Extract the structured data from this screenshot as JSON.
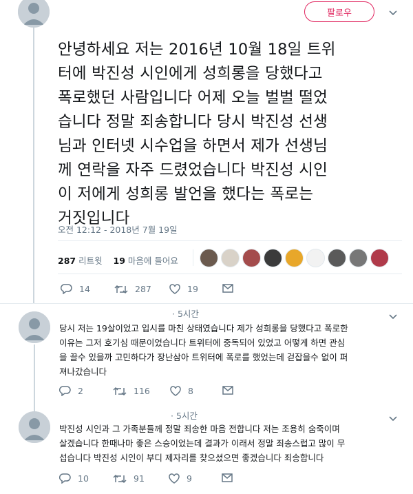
{
  "header": {
    "follow_label": "팔로우"
  },
  "main_tweet": {
    "lines": [
      "안녕하세요 저는 2016년 10월 18일 트위",
      "터에 박진성 시인에게 성희롱을 당했다고",
      "폭로했던 사람입니다 어제 오늘 벌벌 떨었",
      "습니다 정말 죄송합니다 당시 박진성 선생",
      "님과 인터넷 시수업을 하면서 제가 선생님",
      "께 연락을 자주 드렸었습니다 박진성 시인",
      "이 저에게 성희롱 발언을 했다는 폭로는",
      "거짓입니다"
    ],
    "timestamp": "오전 12:12 - 2018년 7월 19일",
    "retweets_count": "287",
    "retweets_label": "리트윗",
    "likes_count": "19",
    "likes_label": "마음에 들어요",
    "actions": {
      "reply": "14",
      "retweet": "287",
      "like": "19"
    }
  },
  "likers": [
    {
      "color": "#6b5a4e"
    },
    {
      "color": "#d9d2c8"
    },
    {
      "color": "#a44c4c"
    },
    {
      "color": "#3b3b3b"
    },
    {
      "color": "#e8a72a"
    },
    {
      "color": "#f2f2f2"
    },
    {
      "color": "#5a5a5a"
    },
    {
      "color": "#777777"
    },
    {
      "color": "#b03a4a"
    }
  ],
  "replies": [
    {
      "time": "· 5시간",
      "lines": [
        "당시 저는 19살이었고 입시를 마친 상태였습니다 제가 성희롱을 당했다고 폭로한",
        "이유는 그저 호기심 때문이었습니다 트위터에 중독되어 있었고 어떻게 하면 관심",
        "을 끌수 있을까 고민하다가 장난삼아 트위터에 폭로를 했었는데 걷잡을수 없이 퍼",
        "져나갔습니다"
      ],
      "reply": "2",
      "retweet": "116",
      "like": "8"
    },
    {
      "time": "· 5시간",
      "lines": [
        "박진성 시인과 그 가족분들께 정말 죄송한 마음 전합니다 저는 조용히 숨죽이며",
        "살겠습니다 한때나마 좋은 스승이었는데 결과가 이래서 정말 죄송스럽고 많이 무",
        "섭습니다 박진성 시인이 부디 제자리를 찾으셨으면 좋겠습니다 죄송합니다"
      ],
      "reply": "10",
      "retweet": "91",
      "like": "9"
    }
  ],
  "colors": {
    "accent": "#e0245e",
    "muted": "#657786",
    "text": "#14171a",
    "divider": "#e6ecf0"
  }
}
